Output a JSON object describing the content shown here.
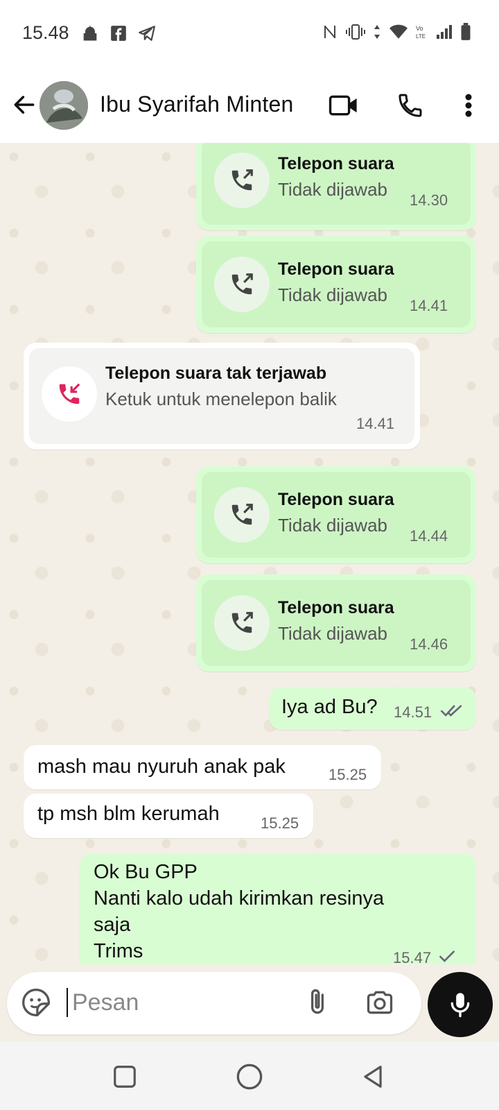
{
  "status_bar": {
    "time": "15.48"
  },
  "header": {
    "contact_name": "Ibu Syarifah Minten"
  },
  "messages": [
    {
      "kind": "call_out",
      "title": "Telepon suara",
      "subtitle": "Tidak dijawab",
      "time": "14.30"
    },
    {
      "kind": "call_out",
      "title": "Telepon suara",
      "subtitle": "Tidak dijawab",
      "time": "14.41"
    },
    {
      "kind": "call_in",
      "title": "Telepon suara tak terjawab",
      "subtitle": "Ketuk untuk menelepon balik",
      "time": "14.41"
    },
    {
      "kind": "call_out",
      "title": "Telepon suara",
      "subtitle": "Tidak dijawab",
      "time": "14.44"
    },
    {
      "kind": "call_out",
      "title": "Telepon suara",
      "subtitle": "Tidak dijawab",
      "time": "14.46"
    },
    {
      "kind": "text_out",
      "text": "Iya ad Bu?",
      "time": "14.51",
      "status": "read"
    },
    {
      "kind": "text_in",
      "text": "mash mau nyuruh anak pak",
      "time": "15.25"
    },
    {
      "kind": "text_in",
      "text": "tp msh blm kerumah",
      "time": "15.25"
    },
    {
      "kind": "text_out",
      "lines": [
        "Ok Bu GPP",
        "Nanti kalo udah kirimkan resinya",
        "saja",
        "Trims"
      ],
      "time": "15.47",
      "status": "sent"
    }
  ],
  "composer": {
    "placeholder": "Pesan"
  },
  "colors": {
    "outgoing": "#d9fdd3",
    "incoming": "#ffffff",
    "missed": "#e0245e",
    "chat_bg": "#f4efe6"
  }
}
